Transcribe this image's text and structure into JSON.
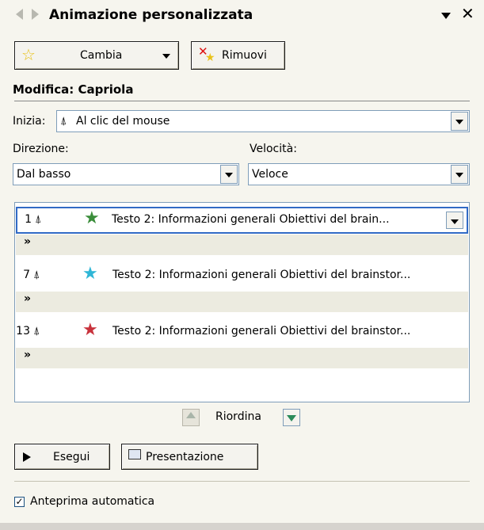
{
  "title": "Animazione personalizzata",
  "toolbar": {
    "change_label": "Cambia",
    "remove_label": "Rimuovi"
  },
  "modify_heading": "Modifica: Capriola",
  "start": {
    "label": "Inizia:",
    "value": "Al clic del mouse"
  },
  "direction": {
    "label": "Direzione:",
    "value": "Dal basso"
  },
  "speed": {
    "label": "Velocità:",
    "value": "Veloce"
  },
  "animations": [
    {
      "number": "1",
      "text": "Testo 2: Informazioni generali Obiettivi del brain...",
      "icon": "star-green-icon",
      "color": "#3a8d3a"
    },
    {
      "number": "7",
      "text": "Testo 2: Informazioni generali Obiettivi del brainstor...",
      "icon": "star-yellow-cyan-icon",
      "color": "#2fb6d6"
    },
    {
      "number": "13",
      "text": "Testo 2: Informazioni generali Obiettivi del brainstor...",
      "icon": "star-red-icon",
      "color": "#c8323c"
    }
  ],
  "reorder_label": "Riordina",
  "play_label": "Esegui",
  "slideshow_label": "Presentazione",
  "autopreview": {
    "label": "Anteprima automatica",
    "checked": true
  }
}
